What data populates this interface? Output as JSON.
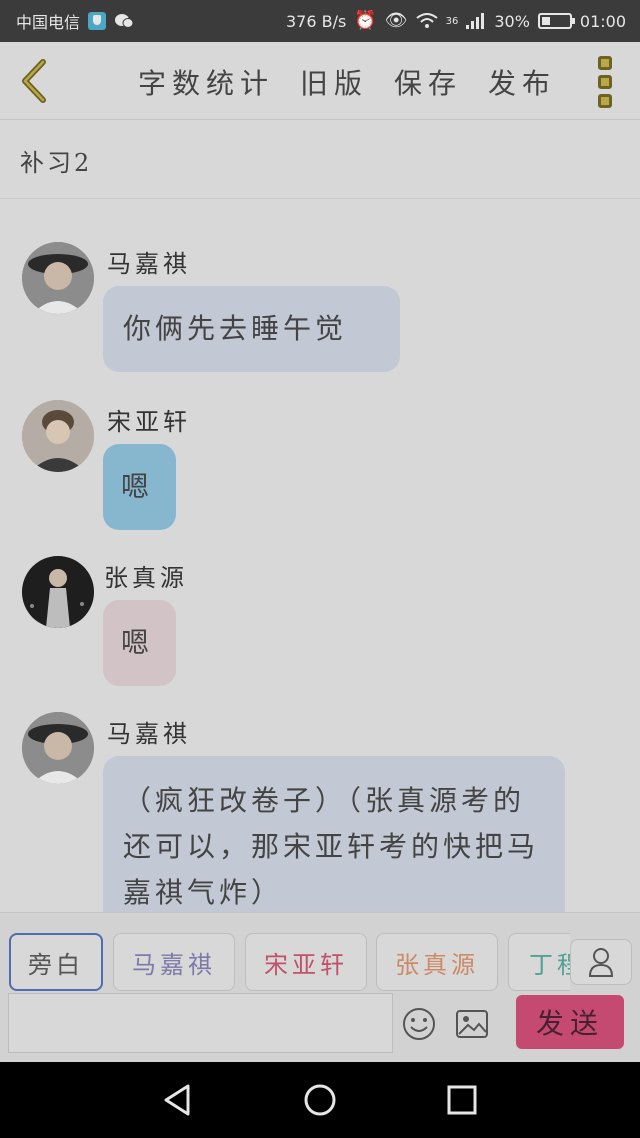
{
  "status_bar": {
    "carrier": "中国电信",
    "speed": "376 B/s",
    "network": "36",
    "battery": "30%",
    "time": "01:00"
  },
  "header": {
    "actions": [
      "字数统计",
      "旧版",
      "保存",
      "发布"
    ]
  },
  "document": {
    "title": "补习2"
  },
  "messages": [
    {
      "sender": "马嘉祺",
      "text": "你俩先去睡午觉",
      "bubble_color": "#c2c8d4"
    },
    {
      "sender": "宋亚轩",
      "text": "嗯",
      "bubble_color": "#86b7cf"
    },
    {
      "sender": "张真源",
      "text": "嗯",
      "bubble_color": "#d2c4c6"
    },
    {
      "sender": "马嘉祺",
      "text": "（疯狂改卷子）（张真源考的还可以，那宋亚轩考的快把马嘉祺气炸）",
      "bubble_color": "#c2c8d4"
    }
  ],
  "characters": [
    {
      "label": "旁白",
      "color": "#555555"
    },
    {
      "label": "马嘉祺",
      "color": "#7b7aa8"
    },
    {
      "label": "宋亚轩",
      "color": "#c0526a"
    },
    {
      "label": "张真源",
      "color": "#cc8a66"
    },
    {
      "label": "丁程鑫",
      "color": "#4fa294"
    }
  ],
  "composer": {
    "input_value": "",
    "send_label": "发送"
  },
  "icons": {
    "back": "chevron-left-icon",
    "more": "more-vertical-icon",
    "person": "person-icon",
    "emoji": "emoji-icon",
    "image": "image-icon"
  },
  "colors": {
    "accent": "#c44a72",
    "header_icon": "#6e6220"
  }
}
